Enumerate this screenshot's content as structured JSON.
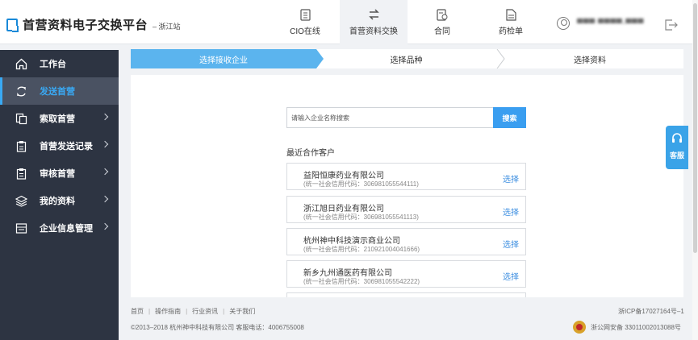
{
  "brand": {
    "title": "首营资料电子交换平台",
    "subtitle": "浙江站"
  },
  "nav": [
    {
      "label": "CIO在线",
      "icon": "document-icon"
    },
    {
      "label": "首营资料交换",
      "icon": "exchange-icon",
      "active": true
    },
    {
      "label": "合同",
      "icon": "contract-icon"
    },
    {
      "label": "药检单",
      "icon": "report-icon"
    }
  ],
  "user": {
    "name": "▀▀▀ ▀▀▀▀-▀▀▀"
  },
  "sidebar": {
    "items": [
      {
        "label": "工作台",
        "icon": "home-icon",
        "arrow": false
      },
      {
        "label": "发送首营",
        "icon": "send-icon",
        "arrow": false,
        "active": true
      },
      {
        "label": "索取首营",
        "icon": "request-icon",
        "arrow": true
      },
      {
        "label": "首营发送记录",
        "icon": "clipboard-icon",
        "arrow": true
      },
      {
        "label": "审核首营",
        "icon": "audit-icon",
        "arrow": true
      },
      {
        "label": "我的资料",
        "icon": "layers-icon",
        "arrow": true
      },
      {
        "label": "企业信息管理",
        "icon": "building-icon",
        "arrow": true
      }
    ]
  },
  "steps": {
    "step1": "选择接收企业",
    "step2": "选择品种",
    "step3": "选择资料"
  },
  "search": {
    "placeholder": "请输入企业名称搜索",
    "button": "搜索"
  },
  "recent": {
    "title": "最近合作客户",
    "select_label": "选择",
    "customers": [
      {
        "name": "益阳恒康药业有限公司",
        "code": "(统一社会信用代码：306981055544111)"
      },
      {
        "name": "浙江旭日药业有限公司",
        "code": "(统一社会信用代码：306981055541113)"
      },
      {
        "name": "杭州神中科技演示商业公司",
        "code": "(统一社会信用代码：210921004041666)"
      },
      {
        "name": "新乡九州通医药有限公司",
        "code": "(统一社会信用代码：306981055542222)"
      }
    ]
  },
  "footer": {
    "links": [
      "首页",
      "操作指南",
      "行业资讯",
      "关于我们"
    ],
    "copyright": "©2013–2018  杭州神中科技有限公司  客服电话：4006755008",
    "icp": "浙ICP备17027164号–1",
    "police": "浙公网安备 33011002013088号"
  },
  "service": {
    "label": "客服"
  },
  "colors": {
    "accent": "#3a9ef0",
    "sidebar_bg": "#2d3442",
    "step_active": "#5bb4ee"
  }
}
